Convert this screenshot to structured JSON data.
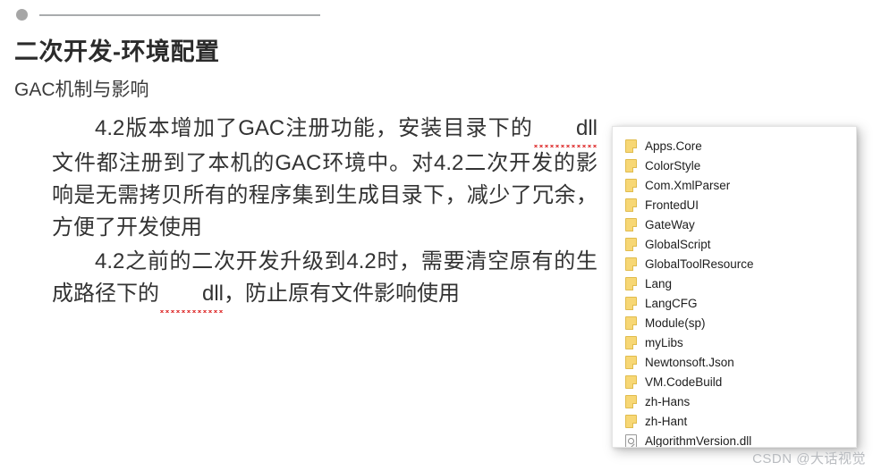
{
  "slide": {
    "top_marker": {
      "dot_color": "#a6a6a6",
      "rule_color": "#a9abad"
    },
    "title": "二次开发-环境配置",
    "subtitle": "GAC机制与影响",
    "paragraphs": [
      {
        "id": "p1",
        "segments": [
          {
            "text": "4.2版本增加了GAC注册功能，安装目录下的",
            "misspelled": false
          },
          {
            "text": "dll",
            "misspelled": true
          },
          {
            "text": "文件都注册到了本机的GAC环境中。对4.2二次开发的影响是无需拷贝所有的程序集到生成目录下，减少了冗余，方便了开发使用",
            "misspelled": false
          }
        ]
      },
      {
        "id": "p2",
        "segments": [
          {
            "text": "4.2之前的二次开发升级到4.2时，需要清空原有的生成路径下的",
            "misspelled": false
          },
          {
            "text": "dll",
            "misspelled": true
          },
          {
            "text": "，防止原有文件影响使用",
            "misspelled": false
          }
        ]
      }
    ]
  },
  "file_panel": {
    "items": [
      {
        "name": "Apps.Core",
        "icon": "folder-icon"
      },
      {
        "name": "ColorStyle",
        "icon": "folder-icon"
      },
      {
        "name": "Com.XmlParser",
        "icon": "folder-icon"
      },
      {
        "name": "FrontedUI",
        "icon": "folder-icon"
      },
      {
        "name": "GateWay",
        "icon": "folder-icon"
      },
      {
        "name": "GlobalScript",
        "icon": "folder-icon"
      },
      {
        "name": "GlobalToolResource",
        "icon": "folder-icon"
      },
      {
        "name": "Lang",
        "icon": "folder-icon"
      },
      {
        "name": "LangCFG",
        "icon": "folder-icon"
      },
      {
        "name": "Module(sp)",
        "icon": "folder-icon"
      },
      {
        "name": "myLibs",
        "icon": "folder-icon"
      },
      {
        "name": "Newtonsoft.Json",
        "icon": "folder-icon"
      },
      {
        "name": "VM.CodeBuild",
        "icon": "folder-icon"
      },
      {
        "name": "zh-Hans",
        "icon": "folder-icon"
      },
      {
        "name": "zh-Hant",
        "icon": "folder-icon"
      },
      {
        "name": "AlgorithmVersion.dll",
        "icon": "dll-file-icon"
      }
    ],
    "folder_color": "#f7d775"
  },
  "watermark": {
    "text": "CSDN @大话视觉"
  }
}
